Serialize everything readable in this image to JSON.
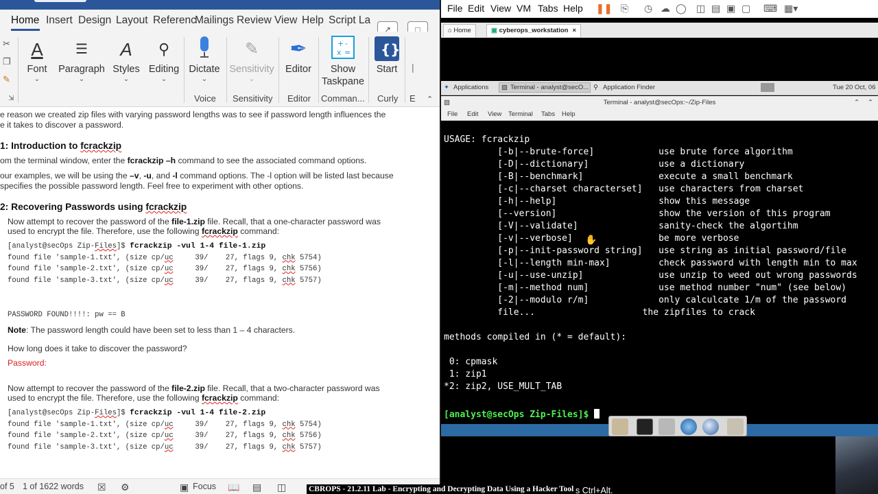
{
  "word": {
    "tabs": [
      "Home",
      "Insert",
      "Design",
      "Layout",
      "Referenc",
      "Mailings",
      "Review",
      "View",
      "Help",
      "Script La"
    ],
    "ribbon": {
      "font": "Font",
      "paragraph": "Paragraph",
      "styles": "Styles",
      "editing": "Editing",
      "dictate": "Dictate",
      "sensitivity": "Sensitivity",
      "editor": "Editor",
      "show_taskpane_1": "Show",
      "show_taskpane_2": "Taskpane",
      "start": "Start",
      "groups": {
        "voice": "Voice",
        "sensitivity": "Sensitivity",
        "editor": "Editor",
        "commands": "Comman...",
        "curly": "Curly",
        "more": "E"
      }
    },
    "doc": {
      "intro_1": "e reason we created zip files with varying password lengths was to see if password length influences the",
      "intro_2": "e it takes to discover a password.",
      "h1_prefix": "1: Introduction to ",
      "h1_tool": "fcrackzip",
      "p1_a": "om the terminal window, enter the ",
      "p1_cmd": "fcrackzip –h",
      "p1_b": " command to see the associated command options.",
      "p2_a": "our examples, we will be using the ",
      "p2_v": "–v",
      "p2_sep1": ", ",
      "p2_u": "-u",
      "p2_and": ", and ",
      "p2_l": "-l",
      "p2_b": " command options. The -l option will be listed last because",
      "p2_c": "specifies the possible password length. Feel free to experiment with other options.",
      "h2_prefix": "2: Recovering Passwords using ",
      "h2_tool": "fcrackzip",
      "p3_a": "Now attempt to recover the password of the ",
      "p3_file": "file-1.zip",
      "p3_b": " file. Recall, that a one-character password was",
      "p3_c": "used to encrypt the file. Therefore, use the following ",
      "p3_tool": "fcrackzip",
      "p3_d": " command:",
      "code1": {
        "prompt_a": "[analyst@secOps Zip-",
        "prompt_files": "Files",
        "prompt_b": "]$ ",
        "cmd": "fcrackzip -vul 1-4 file-1.zip",
        "l1_a": "found file 'sample-1.txt', (size cp/",
        "l1_uc": "uc",
        "l1_b": "     39/    27, flags 9, ",
        "l1_chk": "chk",
        "l1_c": " 5754)",
        "l2_a": "found file 'sample-2.txt', (size cp/",
        "l2_uc": "uc",
        "l2_b": "     39/    27, flags 9, ",
        "l2_chk": "chk",
        "l2_c": " 5756)",
        "l3_a": "found file 'sample-3.txt', (size cp/",
        "l3_uc": "uc",
        "l3_b": "     39/    27, flags 9, ",
        "l3_chk": "chk",
        "l3_c": " 5757)",
        "found": "PASSWORD FOUND!!!!: pw == B"
      },
      "note_label": "Note",
      "note_text": ": The password length could have been set to less than 1 – 4 characters.",
      "question": "How long does it take to discover the password?",
      "password_label": "Password:",
      "p4_a": "Now attempt to recover the password of the ",
      "p4_file": "file-2.zip",
      "p4_b": " file. Recall, that a two-character password was",
      "p4_c": "used to encrypt the file. Therefore, use the following ",
      "p4_tool": "fcrackzip",
      "p4_d": " command:",
      "code2": {
        "prompt_a": "[analyst@secOps Zip-",
        "prompt_files": "Files",
        "prompt_b": "]$ ",
        "cmd": "fcrackzip -vul 1-4 file-2.zip",
        "l1_a": "found file 'sample-1.txt', (size cp/",
        "l1_uc": "uc",
        "l1_b": "     39/    27, flags 9, ",
        "l1_chk": "chk",
        "l1_c": " 5754)",
        "l2_a": "found file 'sample-2.txt', (size cp/",
        "l2_uc": "uc",
        "l2_b": "     39/    27, flags 9, ",
        "l2_chk": "chk",
        "l2_c": " 5756)",
        "l3_a": "found file 'sample-3.txt', (size cp/",
        "l3_uc": "uc",
        "l3_b": "     39/    27, flags 9, ",
        "l3_chk": "chk",
        "l3_c": " 5757)"
      }
    },
    "status": {
      "page": "of 5",
      "words": "1 of 1622 words",
      "focus": "Focus"
    }
  },
  "vm": {
    "menu": [
      "File",
      "Edit",
      "View",
      "VM",
      "Tabs",
      "Help"
    ],
    "tabs": {
      "home": "Home",
      "workstation": "cyberops_workstation"
    },
    "panel": {
      "applications": "Applications",
      "terminal_task": "Terminal - analyst@secO...",
      "app_finder": "Application Finder",
      "clock": "Tue 20 Oct, 06"
    },
    "terminal_title": "Terminal - analyst@secOps:~/Zip-Files",
    "terminal_menu": [
      "File",
      "Edit",
      "View",
      "Terminal",
      "Tabs",
      "Help"
    ],
    "terminal_lines": [
      "USAGE: fcrackzip",
      "          [-b|--brute-force]            use brute force algorithm",
      "          [-D|--dictionary]             use a dictionary",
      "          [-B|--benchmark]              execute a small benchmark",
      "          [-c|--charset characterset]   use characters from charset",
      "          [-h|--help]                   show this message",
      "          [--version]                   show the version of this program",
      "          [-V|--validate]               sanity-check the algortihm",
      "          [-v|--verbose]                be more verbose",
      "          [-p|--init-password string]   use string as initial password/file",
      "          [-l|--length min-max]         check password with length min to max",
      "          [-u|--use-unzip]              use unzip to weed out wrong passwords",
      "          [-m|--method num]             use method number \"num\" (see below)",
      "          [-2|--modulo r/m]             only calculcate 1/m of the password",
      "          file...                    the zipfiles to crack",
      "",
      "methods compiled in (* = default):",
      "",
      " 0: cpmask",
      " 1: zip1",
      "*2: zip2, USE_MULT_TAB",
      ""
    ],
    "prompt": "[analyst@secOps Zip-Files]$ ",
    "hint": "s Ctrl+Alt."
  },
  "caption": "CBROPS - 21.2.11 Lab - Encrypting and Decrypting Data Using a Hacker Tool",
  "colors": {
    "word_blue": "#2b579a",
    "terminal_prompt": "#4ff04f",
    "answer_red": "#d81f1f"
  }
}
